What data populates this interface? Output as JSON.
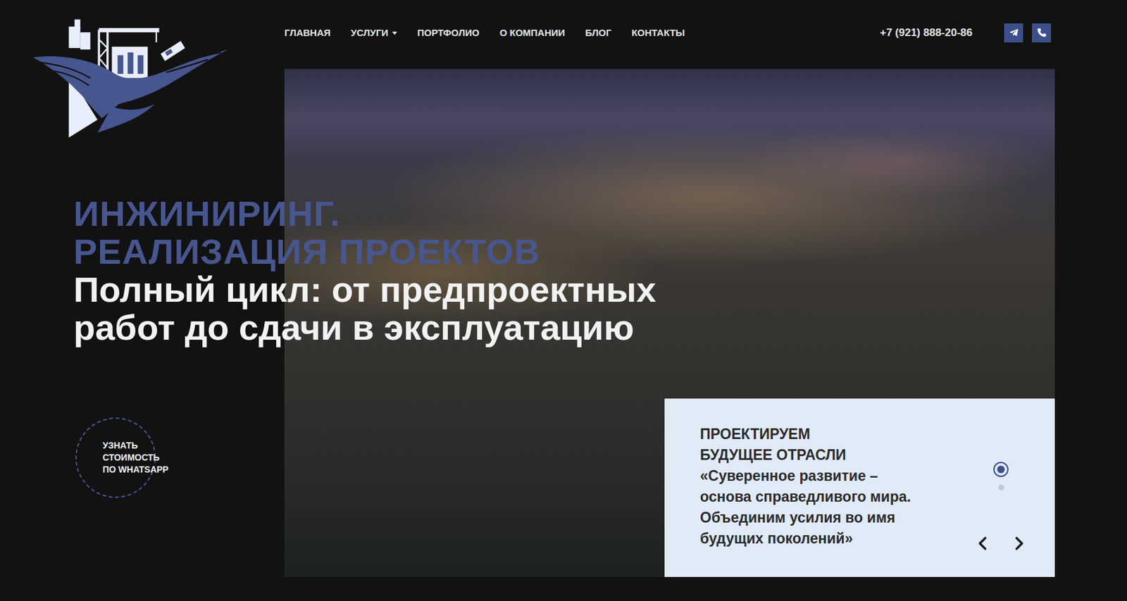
{
  "nav": {
    "items": [
      {
        "label": "ГЛАВНАЯ",
        "hasDropdown": false
      },
      {
        "label": "УСЛУГИ",
        "hasDropdown": true
      },
      {
        "label": "ПОРТФОЛИО",
        "hasDropdown": false
      },
      {
        "label": "О КОМПАНИИ",
        "hasDropdown": false
      },
      {
        "label": "БЛОГ",
        "hasDropdown": false
      },
      {
        "label": "КОНТАКТЫ",
        "hasDropdown": false
      }
    ]
  },
  "contacts": {
    "phone": "+7 (921) 888-20-86"
  },
  "hero": {
    "headline_lines": [
      "ИНЖИНИРИНГ.",
      "РЕАЛИЗАЦИЯ ПРОЕКТОВ"
    ],
    "subheadline_lines": [
      "Полный цикл: от предпроектных",
      "работ до сдачи в эксплуатацию"
    ]
  },
  "cta": {
    "lines": [
      "УЗНАТЬ",
      "СТОИМОСТЬ",
      "ПО WHATSAPP"
    ]
  },
  "slide": {
    "title_lines": [
      "ПРОЕКТИРУЕМ",
      "БУДУЩЕЕ ОТРАСЛИ"
    ],
    "quote_lines": [
      "«Суверенное развитие –",
      "основа справедливого мира.",
      "Объединим усилия во имя",
      "будущих поколений»"
    ]
  },
  "slider": {
    "dots": [
      {
        "selected": true
      },
      {
        "selected": false
      }
    ]
  }
}
